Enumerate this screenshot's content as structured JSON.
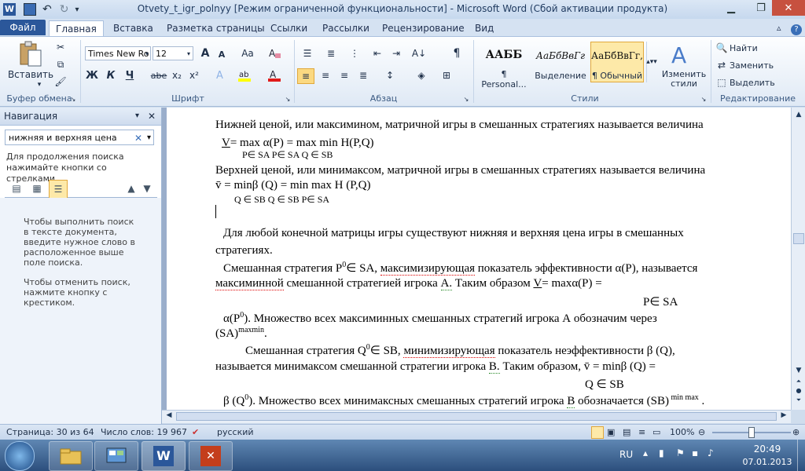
{
  "window": {
    "title": "Otvety_t_igr_polnyy [Режим ограниченной функциональности]  -  Microsoft Word (Сбой активации продукта)"
  },
  "tabs": [
    "Файл",
    "Главная",
    "Вставка",
    "Разметка страницы",
    "Ссылки",
    "Рассылки",
    "Рецензирование",
    "Вид"
  ],
  "ribbon": {
    "clipboard": {
      "paste": "Вставить",
      "group": "Буфер обмена"
    },
    "font": {
      "name": "Times New Ro",
      "size": "12",
      "group": "Шрифт",
      "bold": "Ж",
      "italic": "К",
      "underline": "Ч",
      "strike": "abe",
      "sub": "x₂",
      "sup": "x²",
      "grow": "A",
      "shrink": "A",
      "case": "Aa"
    },
    "paragraph": {
      "group": "Абзац"
    },
    "styles": {
      "group": "Стили",
      "items": [
        {
          "sample": "ААББ",
          "name": "¶ Personal..."
        },
        {
          "sample": "АаБбВвГг",
          "name": "Выделение"
        },
        {
          "sample": "АаБбВвГг,",
          "name": "¶ Обычный"
        }
      ],
      "change": "Изменить стили"
    },
    "editing": {
      "group": "Редактирование",
      "find": "Найти",
      "replace": "Заменить",
      "select": "Выделить"
    }
  },
  "nav": {
    "title": "Навигация",
    "search_value": "нижняя и верхняя цена",
    "hint": "Для продолжения поиска нажимайте кнопки со стрелками",
    "help1": "Чтобы выполнить поиск в тексте документа, введите нужное слово в расположенное выше поле поиска.",
    "help2": "Чтобы отменить поиск, нажмите кнопку с крестиком."
  },
  "document": {
    "l1": "Нижней ценой, или максимином, матричной игры в смешанных стратегиях называется величина",
    "l2a": "V",
    "l2b": "= max α(P) = max  min  H(P,Q)",
    "l3": "P∈ SA        P∈ SA     Q ∈ SB",
    "l4": "Верхней ценой, или минимаксом, матричной игры в смешанных стратегиях называется величина",
    "l5": "v̄ = minβ (Q) = min  max  H (P,Q)",
    "l6": "Q ∈ SB      Q ∈ SB    P∈ SA",
    "l7": "Для любой конечной матрицы игры существуют нижняя и верхняя цена  игры в смешанных",
    "l8": "стратегиях.",
    "l9a": "Смешанная стратегия P",
    "l9b": "0",
    "l9c": "∈ SA, ",
    "l9d": "максимизирующая",
    "l9e": " показатель эффективности α(P),  называется",
    "l10a": "максиминной",
    "l10b": " смешанной стратегией игрока ",
    "l10c": "А.",
    "l10d": " Таким  образом  ",
    "l10e": "V",
    "l10f": "= maxα(P) =",
    "l11": "P∈ SA",
    "l12a": "α(P",
    "l12b": "0",
    "l12c": "). Множество всех максиминных смешанных стратегий игрока А обозначим через",
    "l13a": "(SA)",
    "l13b": "maxmin",
    "l13c": ".",
    "l14a": "Смешанная стратегия Q",
    "l14b": "0",
    "l14c": "∈ SB, ",
    "l14d": "минимизирующая",
    "l14e": " показатель неэффективности β (Q),",
    "l15a": "называется минимаксом смешанной стратегии игрока ",
    "l15b": "В.",
    "l15c": " Таким образом,  v̄ = minβ (Q) =",
    "l16": "Q ∈ SB",
    "l17a": "β (Q",
    "l17b": "0",
    "l17c": "). Множество всех минимаксных смешанных стратегий игрока ",
    "l17d": "В",
    "l17e": " обозначается (SB)",
    "l17f": " min max",
    "l17g": " ."
  },
  "status": {
    "page": "Страница: 30 из 64",
    "words": "Число слов: 19 967",
    "lang": "русский",
    "zoom": "100%"
  },
  "tray": {
    "lang": "RU",
    "time": "20:49",
    "date": "07.01.2013"
  }
}
